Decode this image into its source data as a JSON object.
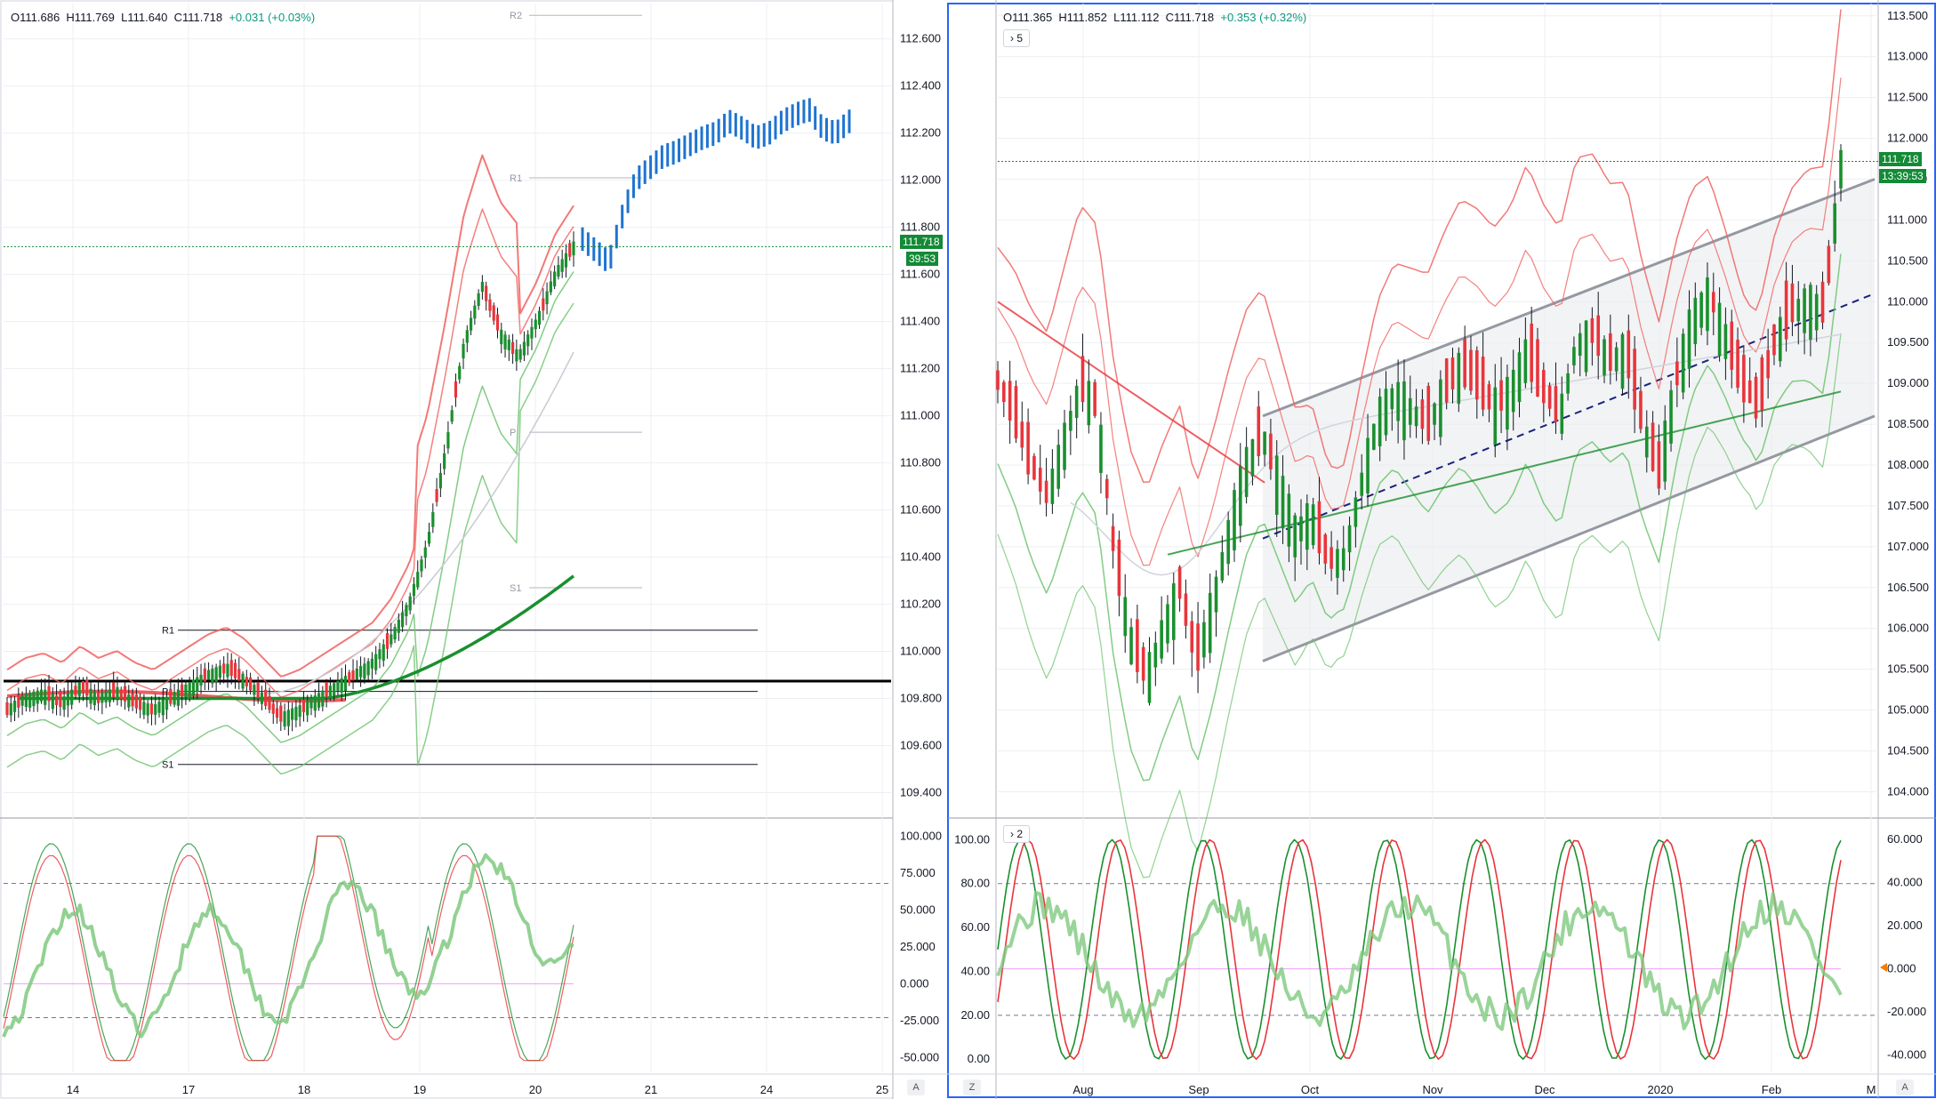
{
  "left_chart": {
    "ohlc": {
      "o": "O111.686",
      "h": "H111.769",
      "l": "L111.640",
      "c": "C111.718",
      "change": "+0.031 (+0.03%)"
    },
    "price_tag": "111.718",
    "countdown_tag": "39:53",
    "y_ticks": [
      "112.600",
      "112.400",
      "112.200",
      "112.000",
      "111.800",
      "111.600",
      "111.400",
      "111.200",
      "111.000",
      "110.800",
      "110.600",
      "110.400",
      "110.200",
      "110.000",
      "109.800",
      "109.600",
      "109.400"
    ],
    "x_ticks": [
      "14",
      "17",
      "18",
      "19",
      "20",
      "21",
      "24",
      "25"
    ],
    "pivot_labels": {
      "current": [
        "R1",
        "P",
        "S1"
      ],
      "next": [
        "R2",
        "R1",
        "P",
        "S1"
      ]
    },
    "osc_ticks": [
      "100.000",
      "75.000",
      "50.000",
      "25.000",
      "0.000",
      "-25.000",
      "-50.000"
    ],
    "axis_button": "A"
  },
  "right_chart": {
    "ohlc": {
      "o": "O111.365",
      "h": "H111.852",
      "l": "L111.112",
      "c": "C111.718",
      "change": "+0.353 (+0.32%)"
    },
    "collapse_main": "5",
    "collapse_osc": "2",
    "price_tag": "111.718",
    "countdown_tag": "13:39:53",
    "y_ticks": [
      "113.500",
      "113.000",
      "112.500",
      "112.000",
      "111.500",
      "111.000",
      "110.500",
      "110.000",
      "109.500",
      "109.000",
      "108.500",
      "108.000",
      "107.500",
      "107.000",
      "106.500",
      "106.000",
      "105.500",
      "105.000",
      "104.500",
      "104.000"
    ],
    "x_ticks": [
      "Aug",
      "Sep",
      "Oct",
      "Nov",
      "Dec",
      "2020",
      "Feb",
      "M"
    ],
    "osc_left_ticks": [
      "100.00",
      "80.00",
      "60.00",
      "40.00",
      "20.00",
      "0.00"
    ],
    "osc_right_ticks": [
      "60.000",
      "40.000",
      "20.000",
      "0.000",
      "-20.000",
      "-40.000"
    ],
    "axis_button_left": "Z",
    "axis_button_right": "A"
  },
  "colors": {
    "up": "#1a8f2e",
    "down": "#e8353b",
    "band_red": "#f0625f",
    "band_green": "#6cc36d",
    "forecast": "#1e74d0",
    "axis_text": "#131722",
    "grid": "#eceff2"
  },
  "chart_data": [
    {
      "type": "line",
      "title": "",
      "x_categories": [
        "14",
        "17",
        "18",
        "19",
        "20",
        "21",
        "24",
        "25"
      ],
      "ylim": [
        109.3,
        112.75
      ],
      "last_price": 111.718,
      "pivots_current": {
        "R1": 110.09,
        "P": 109.83,
        "S1": 109.52
      },
      "pivots_next": {
        "R2": 112.7,
        "R1": 112.01,
        "P": 110.93,
        "S1": 110.27
      },
      "price_path": [
        109.75,
        109.8,
        109.82,
        109.78,
        109.85,
        109.8,
        109.83,
        109.78,
        109.75,
        109.8,
        109.85,
        109.9,
        109.93,
        109.88,
        109.8,
        109.72,
        109.75,
        109.8,
        109.85,
        109.9,
        109.95,
        110.05,
        110.2,
        110.45,
        110.85,
        111.3,
        111.55,
        111.35,
        111.25,
        111.4,
        111.6,
        111.72
      ],
      "forecast_path": [
        111.75,
        111.7,
        111.65,
        111.85,
        112.0,
        112.05,
        112.1,
        112.12,
        112.15,
        112.18,
        112.2,
        112.25,
        112.22,
        112.18,
        112.2,
        112.25,
        112.28,
        112.3,
        112.22,
        112.2,
        112.25
      ],
      "oscillator": {
        "ylim": [
          -60,
          105
        ],
        "bands": [
          68,
          -23
        ]
      }
    },
    {
      "type": "line",
      "title": "",
      "x_categories": [
        "Aug",
        "Sep",
        "Oct",
        "Nov",
        "Dec",
        "2020",
        "Feb",
        "M"
      ],
      "ylim": [
        103.7,
        113.65
      ],
      "last_price": 111.718,
      "channel": {
        "upper": [
          [
            0.0,
            108.6
          ],
          [
            1.0,
            111.5
          ]
        ],
        "lower": [
          [
            0.0,
            105.6
          ],
          [
            1.0,
            108.6
          ]
        ],
        "mid": [
          [
            0.0,
            107.1
          ],
          [
            1.0,
            110.1
          ]
        ]
      },
      "price_path": [
        109.0,
        108.6,
        108.0,
        107.6,
        108.3,
        109.0,
        108.7,
        107.0,
        105.9,
        105.4,
        106.0,
        106.5,
        105.6,
        106.3,
        107.2,
        108.0,
        108.4,
        107.8,
        107.2,
        107.4,
        106.8,
        106.9,
        107.8,
        108.6,
        108.9,
        108.7,
        108.5,
        108.9,
        109.2,
        109.0,
        108.7,
        108.9,
        109.4,
        108.9,
        108.6,
        109.5,
        109.6,
        109.3,
        109.4,
        108.5,
        107.9,
        109.0,
        109.8,
        110.1,
        109.6,
        109.0,
        108.7,
        109.5,
        109.9,
        110.0,
        109.9,
        111.7
      ],
      "oscillator": {
        "left_ylim": [
          -6,
          105
        ],
        "right_ylim": [
          -48,
          65
        ],
        "bands": [
          80,
          20
        ]
      }
    }
  ]
}
